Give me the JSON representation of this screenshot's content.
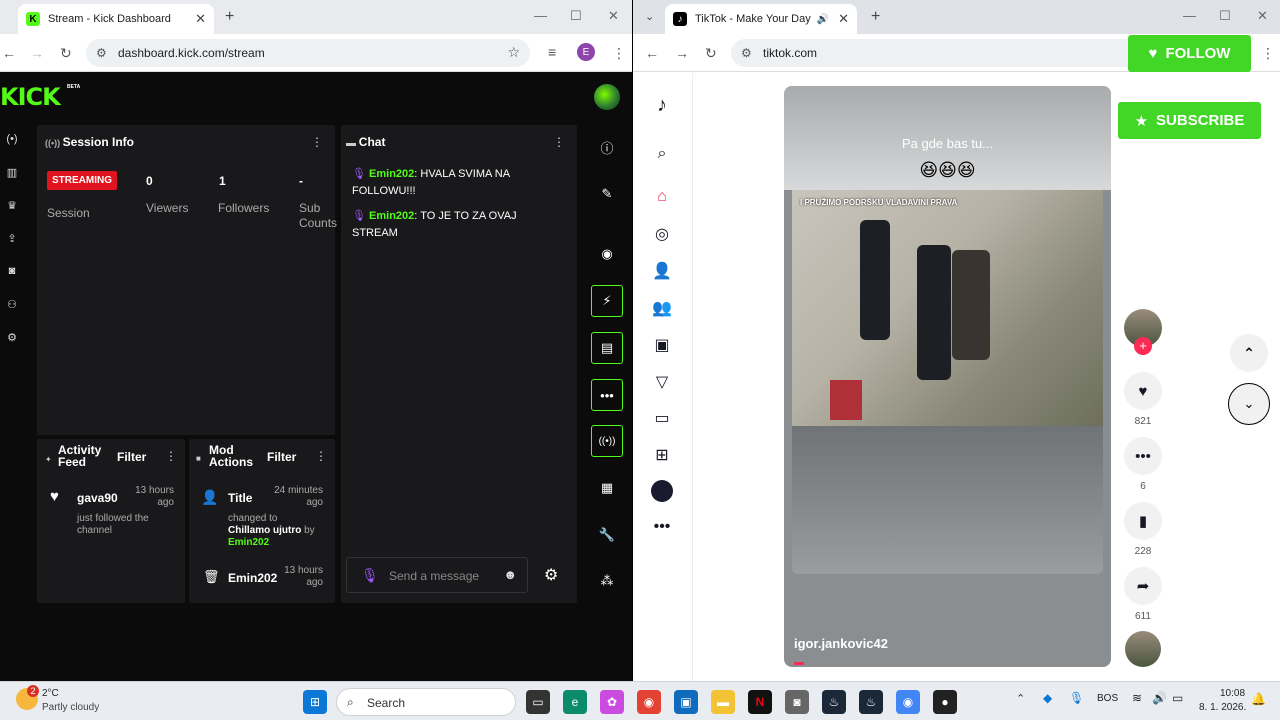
{
  "left_window": {
    "tab_title": "Stream - Kick Dashboard",
    "url": "dashboard.kick.com/stream",
    "profile_initial": "E",
    "logo": "KICK",
    "logo_badge": "BETA",
    "session": {
      "title": "Session Info",
      "badge": "STREAMING",
      "badge_caption": "Session",
      "stats": [
        {
          "value": "0",
          "label": "Viewers"
        },
        {
          "value": "1",
          "label": "Followers"
        },
        {
          "value": "-",
          "label": "Sub Counts"
        }
      ]
    },
    "chat": {
      "title": "Chat",
      "messages": [
        {
          "user": "Emin202",
          "text": ": HVALA SVIMA NA FOLLOWU!!!"
        },
        {
          "user": "Emin202",
          "text": ": TO JE TO ZA OVAJ STREAM"
        }
      ],
      "placeholder": "Send a message"
    },
    "activity": {
      "title": "Activity Feed",
      "filter": "Filter",
      "user": "gava90",
      "time": "13 hours ago",
      "text": "just followed the channel"
    },
    "mod": {
      "title": "Mod Actions",
      "filter": "Filter",
      "item1": {
        "title": "Title",
        "time": "24 minutes ago",
        "text": "changed to",
        "value": "Chillamo ujutro",
        "by": "by",
        "user": "Emin202"
      },
      "item2": {
        "title": "Emin202",
        "time": "13 hours ago"
      }
    }
  },
  "right_window": {
    "tab_title": "TikTok - Make Your Day",
    "url": "tiktok.com",
    "video": {
      "caption": "Pa gde bas tu...",
      "emoji": "😆😆😆",
      "overlay_text": "I PRUŽIMO PODRŠKU VLADAVINI PRAVA",
      "author": "igor.jankovic42"
    },
    "actions": {
      "likes": "821",
      "comments": "6",
      "saves": "228",
      "shares": "611"
    },
    "follow_label": "FOLLOW",
    "subscribe_label": "SUBSCRIBE"
  },
  "taskbar": {
    "temp": "2°C",
    "weather": "Partly cloudy",
    "search": "Search",
    "lang": "BOS",
    "time": "10:08",
    "date": "8. 1. 2026.",
    "notification_badge": "2"
  }
}
